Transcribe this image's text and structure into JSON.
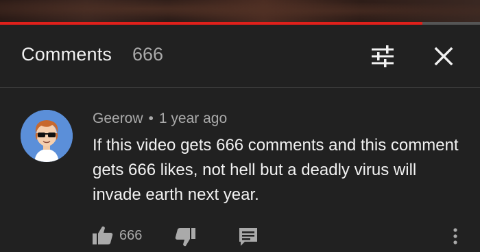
{
  "video": {
    "progress": 0.88
  },
  "header": {
    "title": "Comments",
    "count": "666",
    "sort_icon": "sort-filter-icon",
    "close_icon": "close-icon"
  },
  "comment": {
    "author": "Geerow",
    "separator": "•",
    "time": "1 year ago",
    "text": "If this video gets 666 comments and this comment gets 666 likes, not hell but a deadly virus will invade earth next year.",
    "likes": "666",
    "icons": {
      "like": "thumbs-up-icon",
      "dislike": "thumbs-down-icon",
      "reply": "reply-icon",
      "more": "more-vertical-icon"
    }
  },
  "colors": {
    "background": "#212121",
    "progress": "#e0201b",
    "avatar_bg": "#5b8fd9",
    "secondary_text": "#aaaaaa"
  }
}
